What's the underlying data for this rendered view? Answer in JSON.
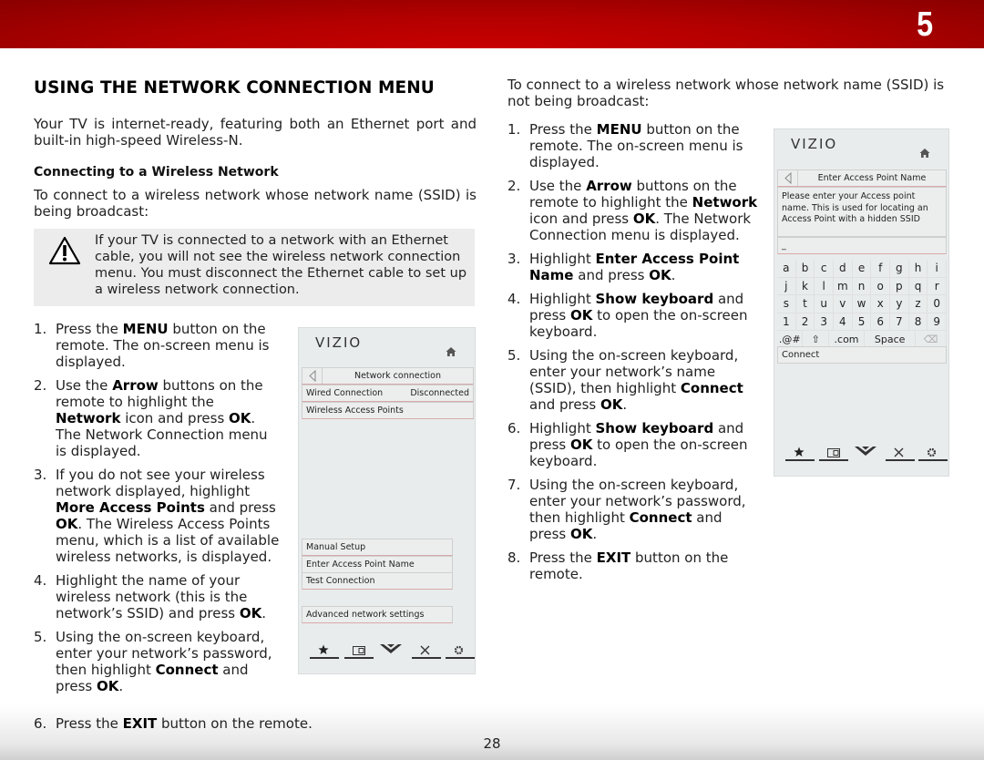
{
  "header": {
    "chapter_number": "5",
    "accent_color": "#c00000"
  },
  "left": {
    "section_title": "USING THE NETWORK CONNECTION MENU",
    "intro": "Your TV is internet-ready, featuring both an Ethernet port and built-in high-speed Wireless-N.",
    "subhead": "Connecting to a Wireless Network",
    "para": "To connect to a wireless network whose network name (SSID) is being broadcast:",
    "note": {
      "icon": "warning-icon",
      "text": "If your TV is connected to a network with an Ethernet cable, you will not see the wireless network connection menu. You must disconnect the Ethernet cable to set up a wireless network connection."
    },
    "steps": [
      {
        "num": "1.",
        "parts": [
          {
            "t": "Press the "
          },
          {
            "b": "MENU"
          },
          {
            "t": " button on the remote. The on-screen menu is displayed."
          }
        ]
      },
      {
        "num": "2.",
        "parts": [
          {
            "t": "Use the "
          },
          {
            "b": "Arrow"
          },
          {
            "t": " buttons on the remote to highlight the "
          },
          {
            "b": "Network"
          },
          {
            "t": " icon and press "
          },
          {
            "b": "OK"
          },
          {
            "t": ". The Network Connection menu is displayed."
          }
        ]
      },
      {
        "num": "3.",
        "parts": [
          {
            "t": "If you do not see your wireless network displayed, highlight "
          },
          {
            "b": "More Access Points"
          },
          {
            "t": " and press "
          },
          {
            "b": "OK"
          },
          {
            "t": ". The Wireless Access Points menu, which is a list of available wireless networks, is displayed."
          }
        ]
      },
      {
        "num": "4.",
        "parts": [
          {
            "t": "Highlight the name of your wireless network (this is the network’s SSID) and press "
          },
          {
            "b": "OK"
          },
          {
            "t": "."
          }
        ]
      },
      {
        "num": "5.",
        "parts": [
          {
            "t": "Using the on-screen keyboard, enter your network’s password, then highlight "
          },
          {
            "b": "Connect"
          },
          {
            "t": " and press "
          },
          {
            "b": "OK"
          },
          {
            "t": "."
          }
        ]
      }
    ],
    "last_step": {
      "num": "6.",
      "parts": [
        {
          "t": "Press the "
        },
        {
          "b": "EXIT"
        },
        {
          "t": " button on the remote."
        }
      ]
    }
  },
  "tv_menu_1": {
    "logo": "VIZIO",
    "title": "Network connection",
    "rows": [
      {
        "label": "Wired Connection",
        "value": "Disconnected"
      },
      {
        "label": "Wireless Access Points",
        "value": ""
      }
    ],
    "lower_rows": [
      "Manual Setup",
      "Enter Access Point Name",
      "Test Connection"
    ],
    "advanced": "Advanced network settings",
    "nav_icons": [
      "star-icon",
      "widget-icon",
      "vizio-v-icon",
      "close-icon",
      "gear-icon"
    ]
  },
  "right": {
    "para": "To connect to a wireless network whose network name (SSID) is not being broadcast:",
    "steps": [
      {
        "num": "1.",
        "parts": [
          {
            "t": "Press the "
          },
          {
            "b": "MENU"
          },
          {
            "t": " button on the remote. The on-screen menu is displayed."
          }
        ]
      },
      {
        "num": "2.",
        "parts": [
          {
            "t": "Use the "
          },
          {
            "b": "Arrow"
          },
          {
            "t": " buttons on the remote to highlight the "
          },
          {
            "b": "Network"
          },
          {
            "t": " icon and press "
          },
          {
            "b": "OK"
          },
          {
            "t": ". The Network Connection menu is displayed."
          }
        ]
      },
      {
        "num": "3.",
        "parts": [
          {
            "t": "Highlight "
          },
          {
            "b": "Enter Access Point Name"
          },
          {
            "t": " and press "
          },
          {
            "b": "OK"
          },
          {
            "t": "."
          }
        ]
      },
      {
        "num": "4.",
        "parts": [
          {
            "t": "Highlight "
          },
          {
            "b": "Show keyboard"
          },
          {
            "t": " and press "
          },
          {
            "b": "OK"
          },
          {
            "t": " to open the on-screen keyboard."
          }
        ]
      },
      {
        "num": "5.",
        "parts": [
          {
            "t": "Using the on-screen keyboard, enter your network’s name (SSID), then highlight "
          },
          {
            "b": "Connect"
          },
          {
            "t": " and press "
          },
          {
            "b": "OK"
          },
          {
            "t": "."
          }
        ]
      },
      {
        "num": "6.",
        "parts": [
          {
            "t": "Highlight "
          },
          {
            "b": "Show keyboard"
          },
          {
            "t": " and press "
          },
          {
            "b": "OK"
          },
          {
            "t": " to open the on-screen keyboard."
          }
        ]
      },
      {
        "num": "7.",
        "parts": [
          {
            "t": "Using the on-screen keyboard, enter your network’s password, then highlight "
          },
          {
            "b": "Connect"
          },
          {
            "t": " and press "
          },
          {
            "b": "OK"
          },
          {
            "t": "."
          }
        ]
      },
      {
        "num": "8.",
        "parts": [
          {
            "t": "Press the "
          },
          {
            "b": "EXIT"
          },
          {
            "t": " button on the remote."
          }
        ]
      }
    ]
  },
  "tv_menu_2": {
    "logo": "VIZIO",
    "title": "Enter Access Point Name",
    "info": "Please enter your Access point name. This is used for locating an Access Point with a hidden SSID",
    "input_value": "_",
    "keyboard_rows": [
      [
        "a",
        "b",
        "c",
        "d",
        "e",
        "f",
        "g",
        "h",
        "i"
      ],
      [
        "j",
        "k",
        "l",
        "m",
        "n",
        "o",
        "p",
        "q",
        "r"
      ],
      [
        "s",
        "t",
        "u",
        "v",
        "w",
        "x",
        "y",
        "z",
        "0"
      ],
      [
        "1",
        "2",
        "3",
        "4",
        "5",
        "6",
        "7",
        "8",
        "9"
      ]
    ],
    "special_keys": [
      ".@#",
      "⇧",
      ".com",
      "Space",
      "⌫"
    ],
    "connect": "Connect",
    "nav_icons": [
      "star-icon",
      "widget-icon",
      "vizio-v-icon",
      "close-icon",
      "gear-icon"
    ]
  },
  "footer": {
    "page_number": "28"
  }
}
